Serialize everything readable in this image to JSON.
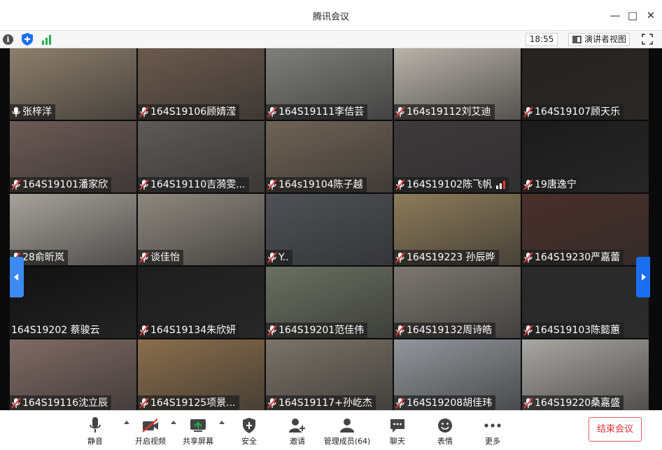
{
  "window": {
    "title": "腾讯会议"
  },
  "statusbar": {
    "time": "18:55",
    "view_mode_label": "演讲者视图"
  },
  "participants": [
    {
      "name": "张梓洋",
      "mic": "on",
      "bg": "#8d7f6c"
    },
    {
      "name": "164S19106顾婧滢",
      "mic": "muted",
      "bg": "#6b5a4e"
    },
    {
      "name": "164S19111李佶芸",
      "mic": "muted",
      "bg": "#7f7f7d"
    },
    {
      "name": "164s19112刘艾迪",
      "mic": "muted",
      "bg": "#b9b3aa"
    },
    {
      "name": "164S19107顾天乐",
      "mic": "muted",
      "bg": "#26231f"
    },
    {
      "name": "164S19101潘家欣",
      "mic": "muted",
      "bg": "#6c5a55"
    },
    {
      "name": "164S19110吉漪雯...",
      "mic": "muted",
      "bg": "#5d5a57"
    },
    {
      "name": "164s19104陈子越",
      "mic": "muted",
      "bg": "#6f6356"
    },
    {
      "name": "164S19102陈飞帆",
      "mic": "muted",
      "bg": "#3e3a3c",
      "signal": true
    },
    {
      "name": "19唐逸宁",
      "mic": "muted",
      "bg": "#1b1b1b"
    },
    {
      "name": "28俞昕岚",
      "mic": "muted",
      "bg": "#a7a39b"
    },
    {
      "name": "谈佳怡",
      "mic": "muted",
      "bg": "#8e887e"
    },
    {
      "name": "Y..",
      "mic": "muted",
      "bg": "#4f5156"
    },
    {
      "name": "164S19223 孙辰晔",
      "mic": "muted",
      "bg": "#8d7b5a"
    },
    {
      "name": "164S19230严嘉蕾",
      "mic": "muted",
      "bg": "#4a2f2a"
    },
    {
      "name": "164S19202 蔡骏云",
      "mic": "none",
      "bg": "#111111"
    },
    {
      "name": "164S19134朱欣妍",
      "mic": "muted",
      "bg": "#1e1e1e"
    },
    {
      "name": "164S19201范佳伟",
      "mic": "muted",
      "bg": "#6b7061"
    },
    {
      "name": "164S19132周诗皓",
      "mic": "muted",
      "bg": "#7c7770"
    },
    {
      "name": "164S19103陈懿蕙",
      "mic": "muted",
      "bg": "#2a2a2a"
    },
    {
      "name": "164S19116沈立辰",
      "mic": "muted",
      "bg": "#7f6a64"
    },
    {
      "name": "164S19125项景...",
      "mic": "muted",
      "bg": "#8a6e4c"
    },
    {
      "name": "164S19117+孙屹杰",
      "mic": "muted",
      "bg": "#7a7468"
    },
    {
      "name": "164S19208胡佳玮",
      "mic": "muted",
      "bg": "#93969b"
    },
    {
      "name": "164S19220桑嘉盛",
      "mic": "muted",
      "bg": "#a8a7a2"
    }
  ],
  "toolbar": {
    "mute": "静音",
    "video": "开启视频",
    "share": "共享屏幕",
    "security": "安全",
    "invite": "邀请",
    "members": "管理成员(64)",
    "chat": "聊天",
    "reactions": "表情",
    "more": "更多",
    "end": "结束会议"
  },
  "colors": {
    "accent": "#1a6ef0",
    "danger": "#e02e2e",
    "muted_mic": "#e53935"
  }
}
